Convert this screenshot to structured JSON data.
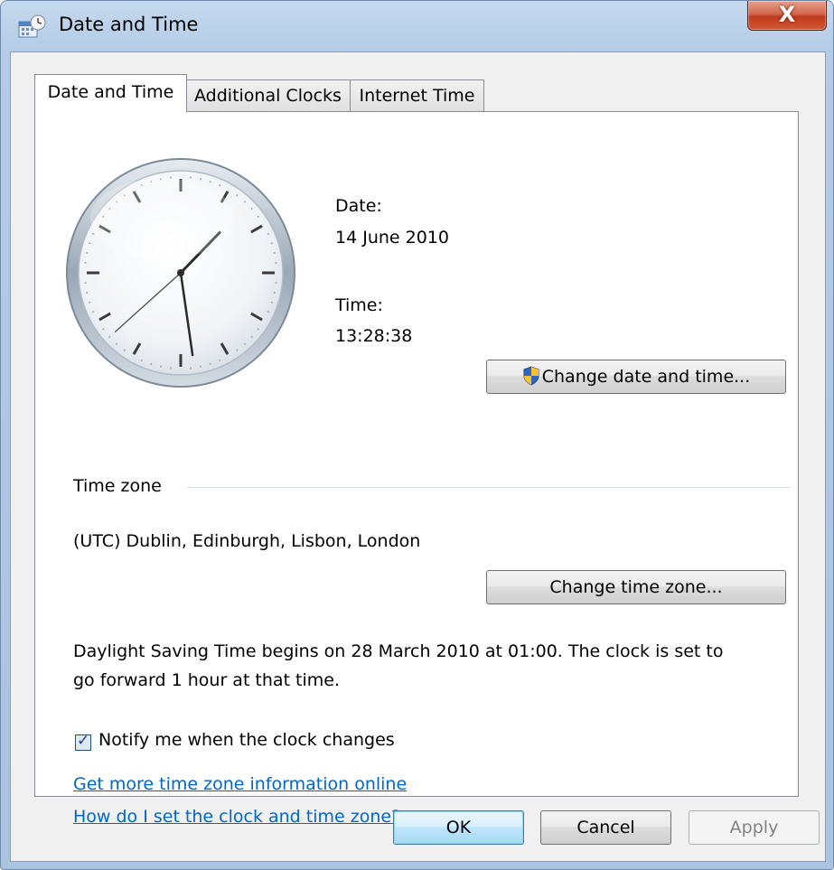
{
  "window": {
    "title": "Date and Time",
    "close_glyph": "X"
  },
  "tabs": [
    {
      "label": "Date and Time",
      "active": true
    },
    {
      "label": "Additional Clocks",
      "active": false
    },
    {
      "label": "Internet Time",
      "active": false
    }
  ],
  "clock": {
    "time": "13:28:38"
  },
  "date": {
    "label": "Date:",
    "value": "14 June 2010"
  },
  "time": {
    "label": "Time:",
    "value": "13:28:38"
  },
  "buttons": {
    "change_date_time": "Change date and time...",
    "change_time_zone": "Change time zone...",
    "ok": "OK",
    "cancel": "Cancel",
    "apply": "Apply"
  },
  "timezone": {
    "header": "Time zone",
    "value": "(UTC) Dublin, Edinburgh, Lisbon, London"
  },
  "dst_notice": {
    "line1": "Daylight Saving Time begins on 28 March 2010 at 01:00. The clock is set to",
    "line2": "go forward 1 hour at that time."
  },
  "notify": {
    "label": "Notify me when the clock changes",
    "checked": true
  },
  "links": {
    "more_info": "Get more time zone information online",
    "how_to": "How do I set the clock and time zone?"
  },
  "colors": {
    "link": "#0066cc",
    "close_button": "#c0391c"
  },
  "icons": [
    "date-time-app-icon",
    "close-icon",
    "uac-shield-icon",
    "checkmark-icon"
  ]
}
